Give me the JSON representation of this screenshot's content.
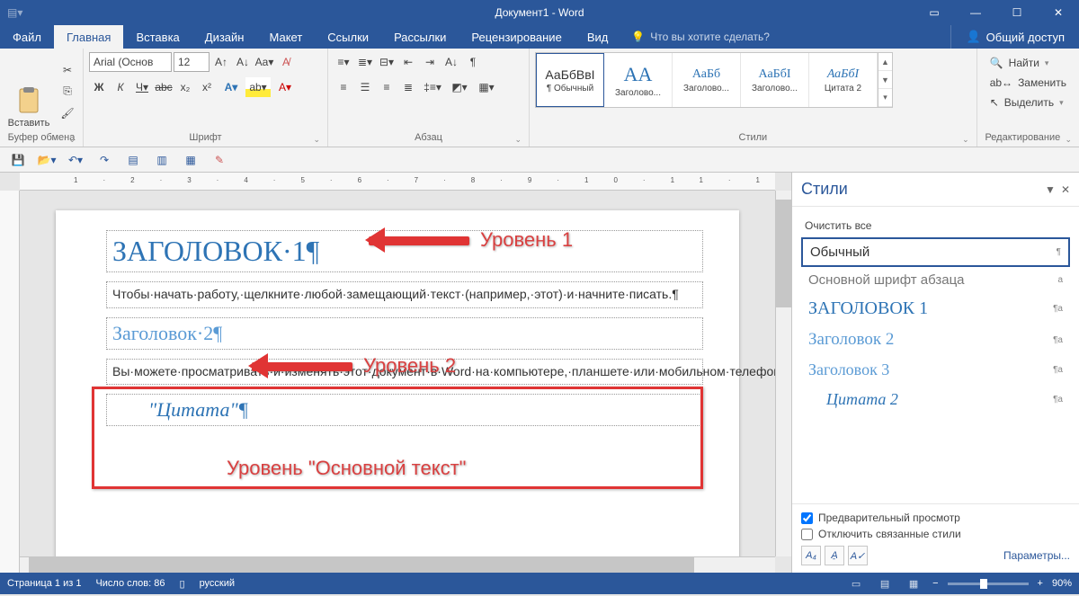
{
  "titlebar": {
    "title": "Документ1 - Word"
  },
  "tabs": {
    "file": "Файл",
    "items": [
      "Главная",
      "Вставка",
      "Дизайн",
      "Макет",
      "Ссылки",
      "Рассылки",
      "Рецензирование",
      "Вид"
    ],
    "active_index": 0,
    "tell_me": "Что вы хотите сделать?",
    "share": "Общий доступ"
  },
  "ribbon": {
    "clipboard": {
      "paste": "Вставить",
      "group": "Буфер обмена"
    },
    "font": {
      "name": "Arial (Основ",
      "size": "12",
      "group": "Шрифт"
    },
    "paragraph": {
      "group": "Абзац"
    },
    "styles": {
      "group": "Стили",
      "items": [
        {
          "preview": "АаБбВвІ",
          "name": "¶ Обычный",
          "cls": "",
          "selected": true
        },
        {
          "preview": "AA",
          "name": "Заголово...",
          "cls": "big-blue"
        },
        {
          "preview": "АаБб",
          "name": "Заголово...",
          "cls": "blue"
        },
        {
          "preview": "АаБбІ",
          "name": "Заголово...",
          "cls": "blue"
        },
        {
          "preview": "АаБбІ",
          "name": "Цитата 2",
          "cls": "blue"
        }
      ]
    },
    "editing": {
      "find": "Найти",
      "replace": "Заменить",
      "select": "Выделить",
      "group": "Редактирование"
    }
  },
  "document": {
    "h1": "ЗАГОЛОВОК·1¶",
    "body1": "Чтобы·начать·работу,·щелкните·любой·замещающий·текст·(например,·этот)·и·начните·писать.¶",
    "h2": "Заголовок·2¶",
    "body2": "Вы·можете·просматривать·и·изменять·этот·документ·в·Word·на·компьютере,·планшете·или·мобильном·телефоне.·Редактируйте·текст,·вставляйте·содержимое,·например·рисунки,·фигуры·и·таблицы,·и·сохраняйте·документ·в·облаке·с·помощью·приложения·Word·на·компьютерах·Mac,·устройствах·iOS,·Android·и·Windows.¶",
    "quote": "\"Цитата\"¶"
  },
  "annotations": {
    "level1": "Уровень 1",
    "level2": "Уровень 2",
    "bodylevel": "Уровень \"Основной текст\""
  },
  "styles_pane": {
    "title": "Стили",
    "clear_all": "Очистить все",
    "styles": [
      {
        "label": "Обычный",
        "cls": "sr-normal",
        "mark": "¶",
        "active": true
      },
      {
        "label": "Основной шрифт абзаца",
        "cls": "sr-para",
        "mark": "a"
      },
      {
        "label": "ЗАГОЛОВОК 1",
        "cls": "sr-h1",
        "mark": "¶a"
      },
      {
        "label": "Заголовок 2",
        "cls": "sr-h2",
        "mark": "¶a"
      },
      {
        "label": "Заголовок 3",
        "cls": "sr-h3",
        "mark": "¶a"
      },
      {
        "label": "Цитата 2",
        "cls": "sr-quote",
        "mark": "¶a"
      }
    ],
    "preview": "Предварительный просмотр",
    "disable_linked": "Отключить связанные стили",
    "options": "Параметры..."
  },
  "statusbar": {
    "page": "Страница 1 из 1",
    "words": "Число слов: 86",
    "lang": "русский",
    "zoom": "90%"
  }
}
